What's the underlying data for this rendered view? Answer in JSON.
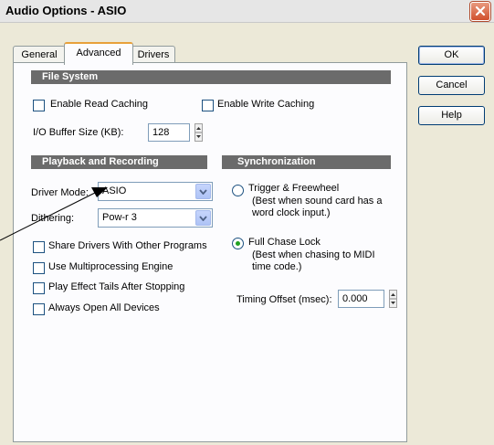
{
  "window": {
    "title": "Audio Options - ASIO"
  },
  "tabs": [
    {
      "label": "General",
      "active": false
    },
    {
      "label": "Advanced",
      "active": true
    },
    {
      "label": "Drivers",
      "active": false
    }
  ],
  "buttons": {
    "ok": "OK",
    "cancel": "Cancel",
    "help": "Help"
  },
  "file_system": {
    "heading": "File System",
    "enable_read_caching": {
      "label": "Enable Read Caching",
      "checked": false
    },
    "enable_write_caching": {
      "label": "Enable Write Caching",
      "checked": false
    },
    "io_buffer": {
      "label": "I/O Buffer Size (KB):",
      "value": "128"
    }
  },
  "playback": {
    "heading": "Playback and Recording",
    "driver_mode": {
      "label": "Driver Mode:",
      "value": "ASIO"
    },
    "dithering": {
      "label": "Dithering:",
      "value": "Pow-r 3"
    },
    "options": [
      {
        "label": "Share Drivers With Other Programs",
        "checked": false
      },
      {
        "label": "Use Multiprocessing Engine",
        "checked": false
      },
      {
        "label": "Play Effect Tails After Stopping",
        "checked": false
      },
      {
        "label": "Always Open All Devices",
        "checked": false
      }
    ]
  },
  "sync": {
    "heading": "Synchronization",
    "trigger": {
      "label": "Trigger & Freewheel",
      "line1": "(Best when sound card has a",
      "line2": "word clock input.)",
      "selected": false
    },
    "chase": {
      "label": "Full Chase Lock",
      "line1": "(Best when chasing to MIDI",
      "line2": "time code.)",
      "selected": true
    },
    "timing_offset": {
      "label": "Timing Offset (msec):",
      "value": "0.000"
    }
  },
  "colors": {
    "section_header": "#6b6b6b",
    "dialog_bg": "#ece9d8",
    "close_button": "#d1502d",
    "radio_selected": "#21a121",
    "tab_highlight": "#e8a13a"
  }
}
